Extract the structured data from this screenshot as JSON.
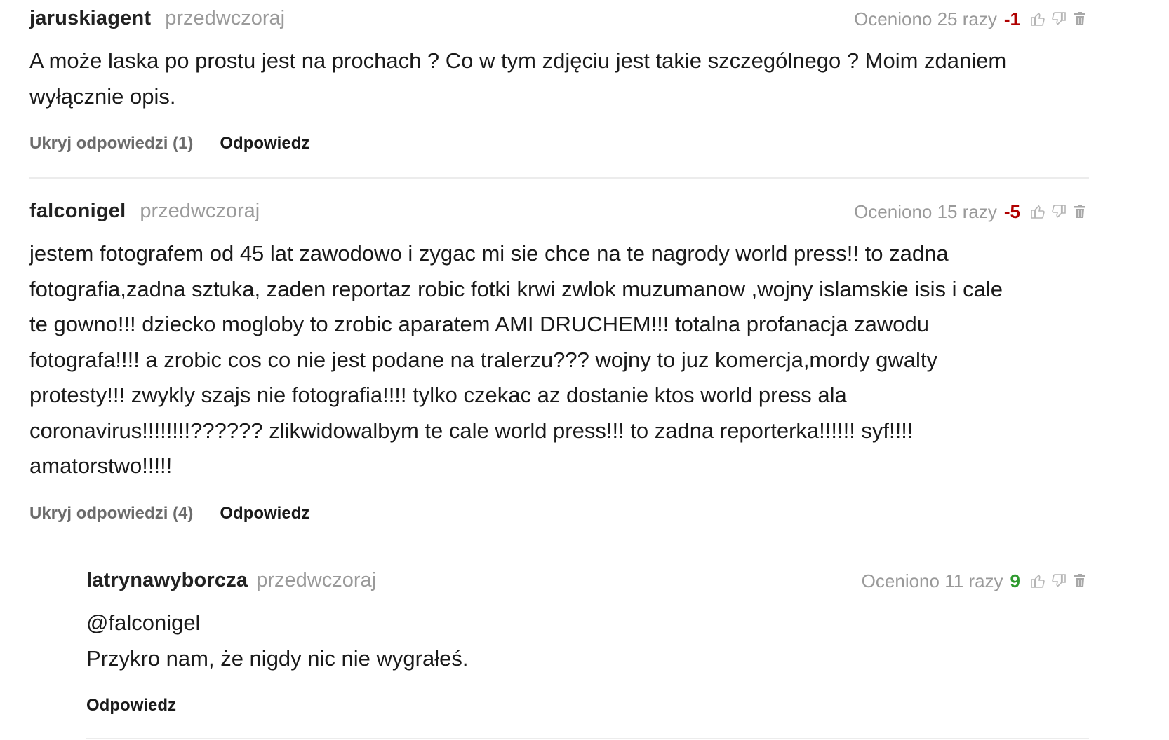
{
  "comments": [
    {
      "author": "jaruskiagent",
      "date": "przedwczoraj",
      "rating_text": "Oceniono 25 razy",
      "score": "-1",
      "body": "A może laska po prostu jest na prochach ? Co w tym zdjęciu jest takie szczególnego ? Moim zdaniem\nwyłącznie opis.",
      "hide_replies_label": "Ukryj odpowiedzi (1)",
      "reply_label": "Odpowiedz"
    },
    {
      "author": "falconigel",
      "date": "przedwczoraj",
      "rating_text": "Oceniono 15 razy",
      "score": "-5",
      "body": "jestem fotografem od 45 lat zawodowo i zygac mi sie chce na te nagrody world press!! to zadna\nfotografia,zadna sztuka, zaden reportaz robic fotki krwi zwlok muzumanow ,wojny islamskie isis i cale\nte gowno!!! dziecko mogloby to zrobic aparatem AMI DRUCHEM!!! totalna profanacja zawodu\nfotografa!!!! a zrobic cos co nie jest podane na tralerzu??? wojny to juz komercja,mordy gwalty\nprotesty!!! zwykly szajs nie fotografia!!!! tylko czekac az dostanie ktos world press ala\ncoronavirus!!!!!!!!?????? zlikwidowalbym te cale world press!!! to zadna reporterka!!!!!! syf!!!!\namatorstwo!!!!!",
      "hide_replies_label": "Ukryj odpowiedzi (4)",
      "reply_label": "Odpowiedz"
    },
    {
      "author": "latrynawyborcza",
      "date": "przedwczoraj",
      "rating_text": "Oceniono 11 razy",
      "score": "9",
      "body": "@falconigel\nPrzykro nam, że nigdy nic nie wygrałeś.",
      "reply_label": "Odpowiedz"
    }
  ],
  "icons": {
    "upvote": "thumbs-up-icon",
    "downvote": "thumbs-down-icon",
    "delete": "trash-icon"
  },
  "colors": {
    "negative_score": "#b00000",
    "positive_score": "#2e9a2e",
    "muted_text": "#9a9a9a"
  }
}
